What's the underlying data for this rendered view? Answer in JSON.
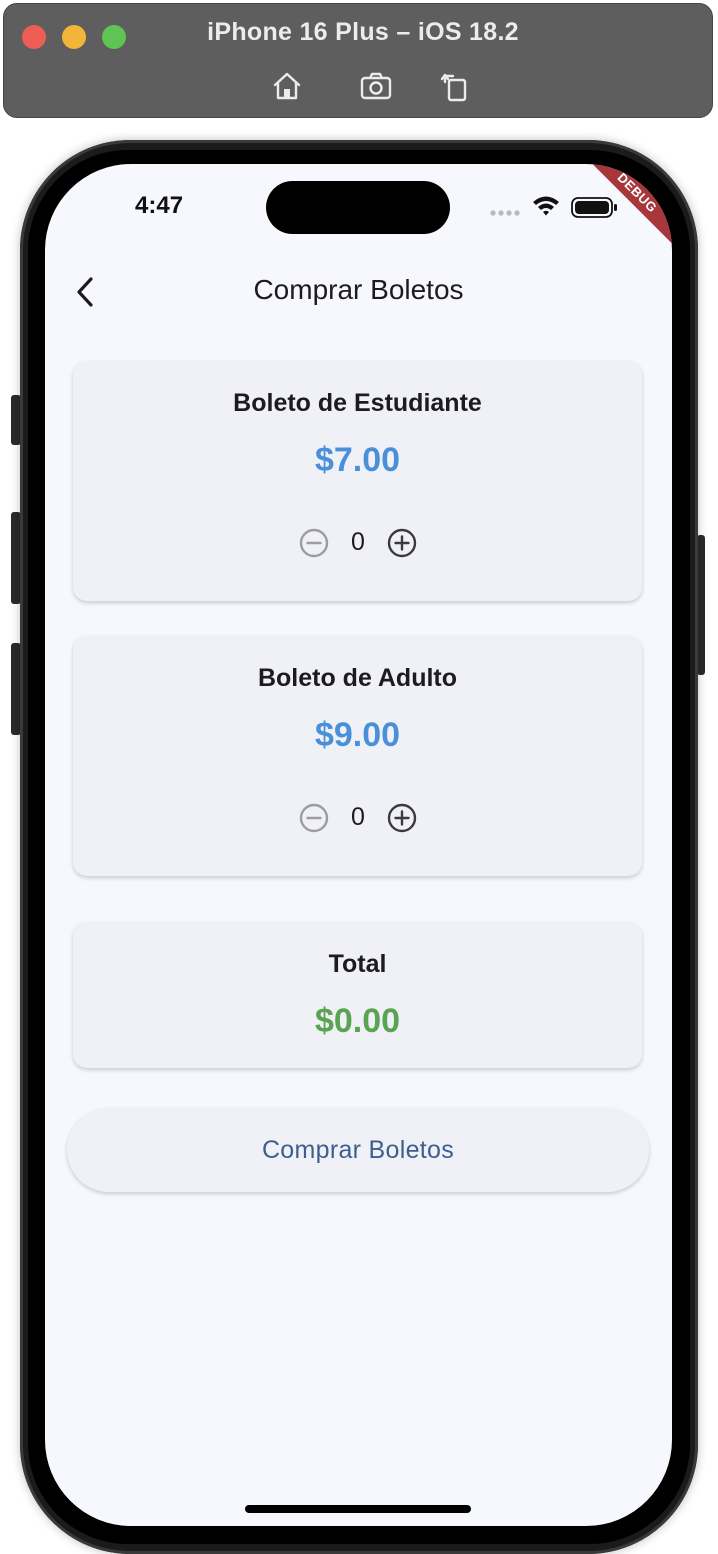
{
  "window": {
    "title": "iPhone 16 Plus – iOS 18.2",
    "toolbar_icons": [
      "home-icon",
      "screenshot-icon",
      "rotate-icon"
    ]
  },
  "status_bar": {
    "time": "4:47",
    "icons": [
      "signal-icon",
      "wifi-icon",
      "battery-icon"
    ],
    "debug_label": "DEBUG"
  },
  "app_bar": {
    "title": "Comprar Boletos",
    "back_icon": "chevron-left-icon"
  },
  "tickets": [
    {
      "title": "Boleto de Estudiante",
      "price": "$7.00",
      "count": "0"
    },
    {
      "title": "Boleto de Adulto",
      "price": "$9.00",
      "count": "0"
    }
  ],
  "total": {
    "label": "Total",
    "value": "$0.00"
  },
  "buy_button": {
    "label": "Comprar Boletos"
  },
  "colors": {
    "price": "#4a90d9",
    "total": "#5aa353",
    "button_text": "#3d5f8f",
    "debug_banner": "#a8373b"
  }
}
